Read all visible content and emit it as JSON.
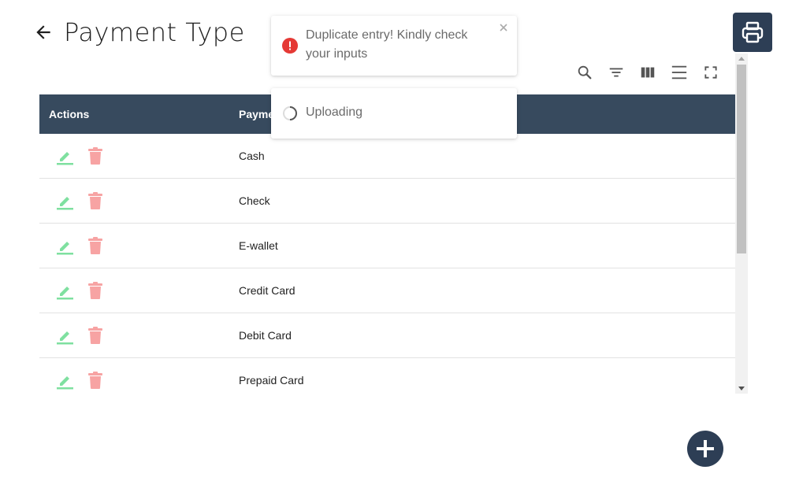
{
  "header": {
    "back_icon": "arrow-left-icon",
    "title": "Payment Type",
    "print_icon": "printer-icon"
  },
  "toolbar": {
    "icons": [
      "search-icon",
      "filter-icon",
      "columns-icon",
      "density-icon",
      "fullscreen-icon"
    ]
  },
  "table": {
    "columns": [
      "Actions",
      "Payment Type"
    ],
    "rows": [
      {
        "name": "Cash"
      },
      {
        "name": "Check"
      },
      {
        "name": "E-wallet"
      },
      {
        "name": "Credit Card"
      },
      {
        "name": "Debit Card"
      },
      {
        "name": "Prepaid Card"
      }
    ],
    "row_icons": {
      "edit": "pencil-icon",
      "delete": "trash-icon"
    }
  },
  "toasts": {
    "error": {
      "message": "Duplicate entry! Kindly check your inputs",
      "icon": "error-icon"
    },
    "loading": {
      "message": "Uploading",
      "icon": "spinner-icon"
    }
  },
  "colors": {
    "header_bg": "#374a5e",
    "accent_dark": "#2d3e55",
    "edit_icon": "#7fe0a0",
    "delete_icon": "#f7a3a3",
    "error": "#e53935"
  },
  "fab": {
    "icon": "plus-icon"
  }
}
